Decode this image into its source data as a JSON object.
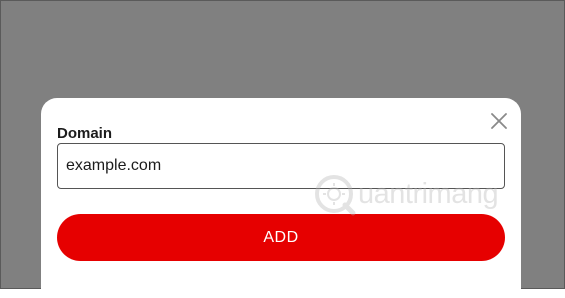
{
  "dialog": {
    "domain_label": "Domain",
    "domain_value": "example.com",
    "add_label": "ADD",
    "close_icon": "close-icon"
  },
  "watermark": {
    "text": "uantrimang"
  },
  "colors": {
    "backdrop": "#808080",
    "accent": "#e60000",
    "modal_bg": "#ffffff"
  }
}
